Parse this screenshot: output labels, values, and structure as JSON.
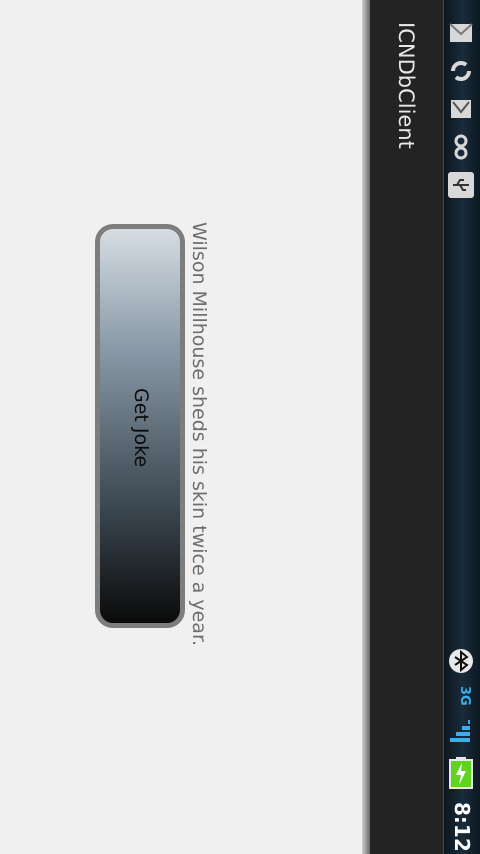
{
  "app": {
    "title": "ICNDbClient"
  },
  "main": {
    "joke_text": "Wilson Millhouse sheds his skin twice a year.",
    "get_joke_label": "Get Joke"
  },
  "status": {
    "time": "8:12",
    "network": "3G",
    "icons": [
      "email-icon",
      "sync-icon",
      "gmail-icon",
      "voicemail-icon",
      "usb-icon",
      "bluetooth-icon",
      "network-3g-icon",
      "signal-icon",
      "battery-charging-icon"
    ]
  },
  "colors": {
    "status_bg": "#0c1720",
    "titlebar_bg": "#232323",
    "accent_3g": "#3bb0e8",
    "battery": "#5fd31d"
  }
}
